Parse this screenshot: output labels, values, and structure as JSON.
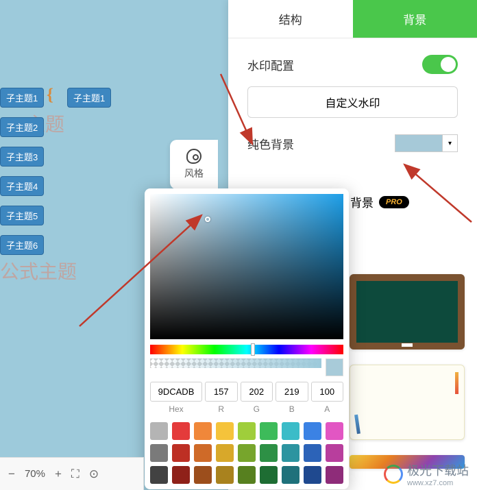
{
  "tabs": {
    "structure": "结构",
    "background": "背景"
  },
  "panel": {
    "watermark_label": "水印配置",
    "custom_watermark": "自定义水印",
    "solid_bg_label": "纯色背景",
    "custom_bg_label": "背景",
    "pro": "PRO"
  },
  "style_fab": "风格",
  "nodes": {
    "right": "子主题1",
    "list": [
      "子主题1",
      "子主题2",
      "子主题3",
      "子主题4",
      "子主题5",
      "子主题6"
    ]
  },
  "ghosts": {
    "a": "主题",
    "b": "公式主题"
  },
  "picker": {
    "hex": "9DCADB",
    "r": "157",
    "g": "202",
    "b": "219",
    "a": "100",
    "labels": {
      "hex": "Hex",
      "r": "R",
      "g": "G",
      "b": "B",
      "a": "A"
    },
    "presets": [
      "#b4b4b4",
      "#e43b3b",
      "#f0873a",
      "#f5c33b",
      "#9fce3b",
      "#3dbb5a",
      "#3bbcc8",
      "#3b82e4",
      "#e256c3",
      "#7a7a7a",
      "#bd2f24",
      "#cf6a28",
      "#d8a82a",
      "#77a52c",
      "#2d9045",
      "#2c94a0",
      "#2c63b8",
      "#b83e9d",
      "#424242",
      "#8f2119",
      "#9c4e1c",
      "#a9821e",
      "#57801f",
      "#1e6d33",
      "#1f717b",
      "#1f498f",
      "#8e2c79"
    ]
  },
  "bottom": {
    "zoom": "70%"
  },
  "site": {
    "name": "极光下载站",
    "url": "www.xz7.com"
  }
}
